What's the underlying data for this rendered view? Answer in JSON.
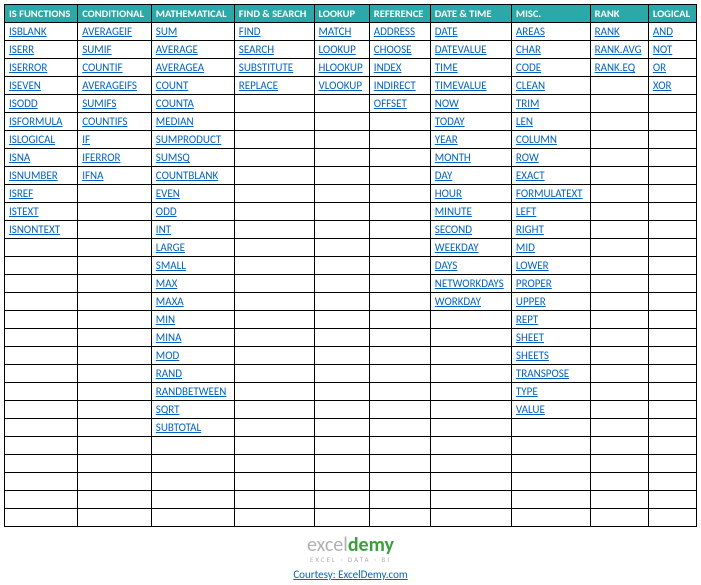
{
  "headers": [
    "IS FUNCTIONS",
    "CONDITIONAL",
    "MATHEMATICAL",
    "FIND & SEARCH",
    "LOOKUP",
    "REFERENCE",
    "DATE & TIME",
    "MISC.",
    "RANK",
    "LOGICAL"
  ],
  "columns": [
    [
      "ISBLANK",
      "ISERR",
      "ISERROR",
      "ISEVEN",
      "ISODD",
      "ISFORMULA",
      "ISLOGICAL",
      "ISNA",
      "ISNUMBER",
      "ISREF",
      "ISTEXT",
      "ISNONTEXT"
    ],
    [
      "AVERAGEIF",
      "SUMIF",
      "COUNTIF",
      "AVERAGEIFS",
      "SUMIFS",
      "COUNTIFS",
      "IF",
      "IFERROR",
      "IFNA"
    ],
    [
      "SUM",
      "AVERAGE",
      "AVERAGEA",
      "COUNT",
      "COUNTA",
      "MEDIAN",
      "SUMPRODUCT",
      "SUMSQ",
      "COUNTBLANK",
      "EVEN",
      "ODD",
      "INT",
      "LARGE",
      "SMALL",
      "MAX",
      "MAXA",
      "MIN",
      "MINA",
      "MOD",
      "RAND",
      "RANDBETWEEN",
      "SQRT",
      "SUBTOTAL"
    ],
    [
      "FIND",
      "SEARCH",
      "SUBSTITUTE",
      "REPLACE"
    ],
    [
      "MATCH",
      "LOOKUP",
      "HLOOKUP",
      "VLOOKUP"
    ],
    [
      "ADDRESS",
      "CHOOSE",
      "INDEX",
      "INDIRECT",
      "OFFSET"
    ],
    [
      "DATE",
      "DATEVALUE",
      "TIME",
      "TIMEVALUE",
      "NOW",
      "TODAY",
      "YEAR",
      "MONTH",
      "DAY",
      "HOUR",
      "MINUTE",
      "SECOND",
      "WEEKDAY",
      "DAYS",
      "NETWORKDAYS",
      "WORKDAY"
    ],
    [
      "AREAS",
      "CHAR",
      "CODE",
      "CLEAN",
      "TRIM",
      "LEN",
      "COLUMN",
      "ROW",
      "EXACT",
      "FORMULATEXT",
      "LEFT",
      "RIGHT",
      "MID",
      "LOWER",
      "PROPER",
      "UPPER",
      "REPT",
      "SHEET",
      "SHEETS",
      "TRANSPOSE",
      "TYPE",
      "VALUE"
    ],
    [
      "RANK",
      "RANK.AVG",
      "RANK.EQ"
    ],
    [
      "AND",
      "NOT",
      "OR",
      "XOR"
    ]
  ],
  "row_count": 28,
  "footer": {
    "logo_main_plain": "excel",
    "logo_main_accent": "demy",
    "logo_sub": "EXCEL · DATA · BI",
    "courtesy": "Courtesy: ExcelDemy.com"
  }
}
